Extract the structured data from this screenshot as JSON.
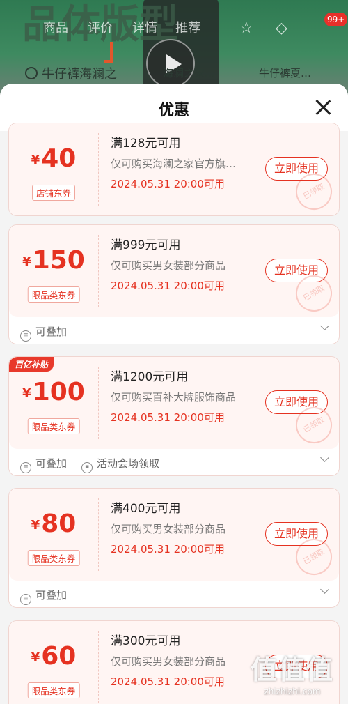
{
  "background": {
    "nav": [
      "商品",
      "评价",
      "详情",
      "推荐"
    ],
    "cart_badge": "99+",
    "big_text": "品体版型",
    "search_text": "牛仔裤海澜之",
    "words": [
      "海澜之家…",
      "牛仔裤夏…"
    ]
  },
  "sheet": {
    "title": "优惠"
  },
  "coupons": [
    {
      "currency": "¥",
      "amount": "40",
      "tag": "店铺东券",
      "condition": "满128元可用",
      "description": "仅可购买海澜之家官方旗…",
      "valid": "2024.05.31 20:00可用",
      "button": "立即使用",
      "stamp": "已领取",
      "footer": []
    },
    {
      "currency": "¥",
      "amount": "150",
      "tag": "限品类东券",
      "condition": "满999元可用",
      "description": "仅可购买男女装部分商品",
      "valid": "2024.05.31 20:00可用",
      "button": "立即使用",
      "stamp": "已领取",
      "footer": [
        "可叠加"
      ]
    },
    {
      "currency": "¥",
      "amount": "100",
      "tag": "限品类东券",
      "condition": "满1200元可用",
      "description": "仅可购买百补大牌服饰商品",
      "valid": "2024.05.31 20:00可用",
      "button": "立即使用",
      "stamp": "已领取",
      "badge": "百亿补贴",
      "footer": [
        "可叠加",
        "活动会场领取"
      ]
    },
    {
      "currency": "¥",
      "amount": "80",
      "tag": "限品类东券",
      "condition": "满400元可用",
      "description": "仅可购买男女装部分商品",
      "valid": "2024.05.31 20:00可用",
      "button": "立即使用",
      "stamp": "已领取",
      "footer": [
        "可叠加"
      ]
    },
    {
      "currency": "¥",
      "amount": "60",
      "tag": "限品类东券",
      "condition": "满300元可用",
      "description": "仅可购买男女装部分商品",
      "valid": "2024.05.31 20:00可用",
      "button": "立即使用",
      "stamp": "",
      "footer": []
    }
  ],
  "watermark": {
    "glyphs": "值值值",
    "url": "zhizhizhi.com"
  }
}
